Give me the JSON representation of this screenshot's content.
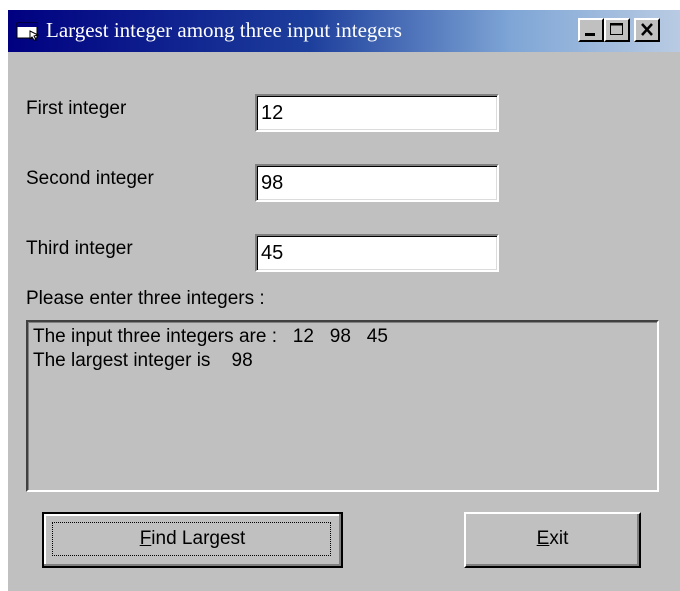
{
  "window": {
    "title": "Largest integer among three input integers",
    "icon": "app-window-icon",
    "controls": [
      "minimize-icon",
      "maximize-icon",
      "close-icon"
    ]
  },
  "fields": [
    {
      "label": "First integer",
      "value": "12"
    },
    {
      "label": "Second integer",
      "value": "98"
    },
    {
      "label": "Third integer",
      "value": "45"
    }
  ],
  "prompt": "Please enter three integers :",
  "output": {
    "line1": "The input three integers are :   12   98   45",
    "line2": "The largest integer is    98"
  },
  "buttons": {
    "find": {
      "mnemonic": "F",
      "rest": "ind Largest"
    },
    "exit": {
      "mnemonic": "E",
      "rest": "xit"
    }
  },
  "colors": {
    "face": "#c0c0c0",
    "title_start": "#000080",
    "title_end": "#b9cbe3"
  }
}
